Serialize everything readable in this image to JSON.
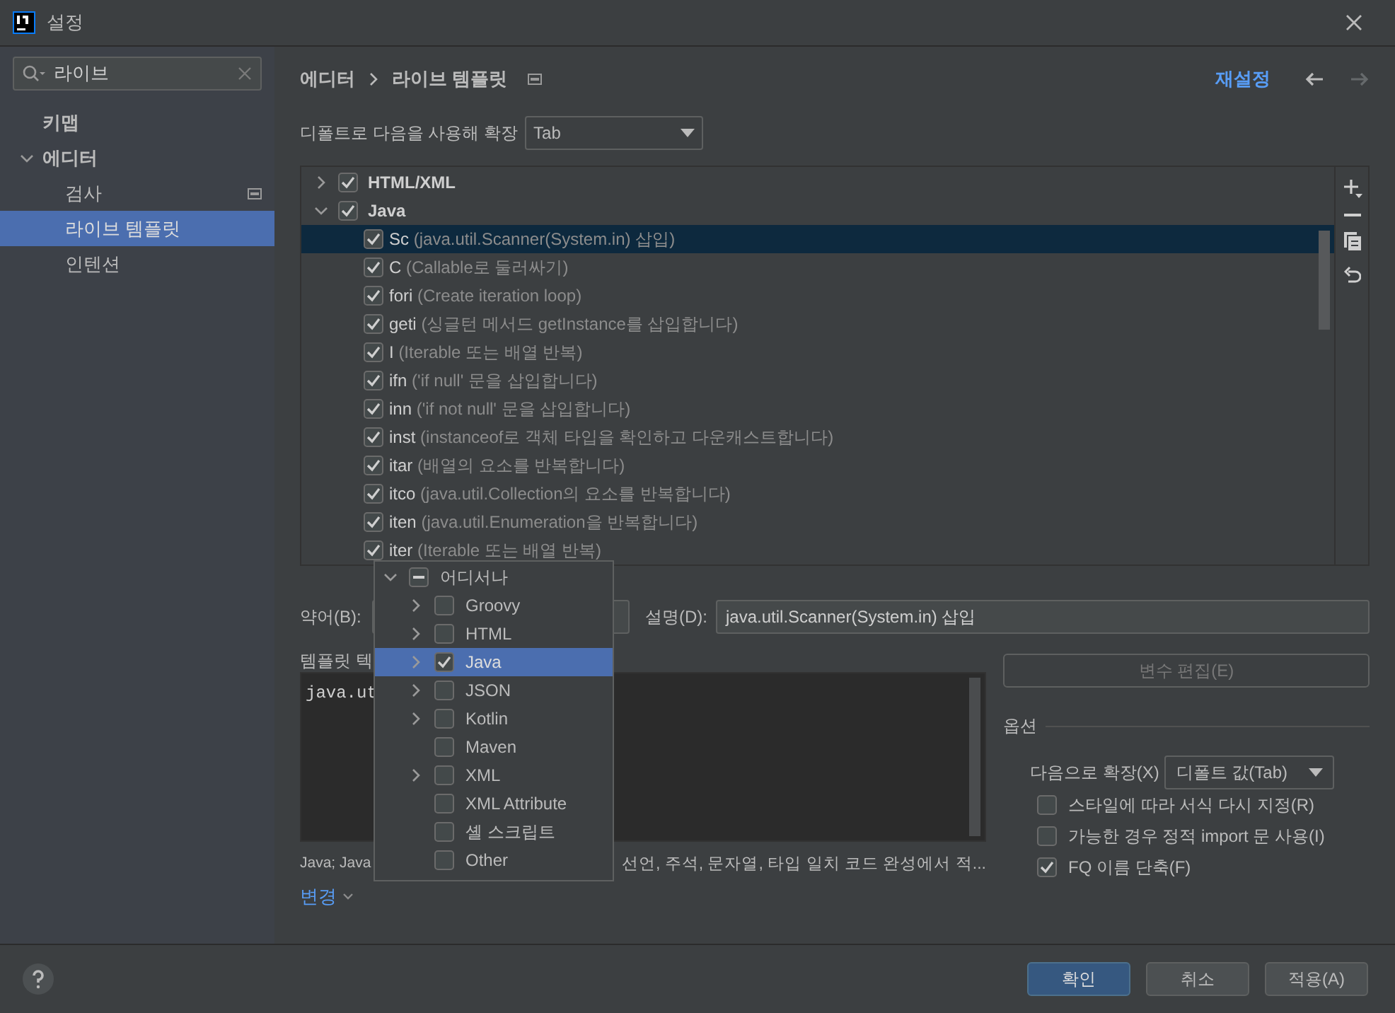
{
  "window": {
    "title": "설정"
  },
  "search": {
    "value": "라이브"
  },
  "sidebar": {
    "items": [
      {
        "label": "키맵",
        "selected": false
      },
      {
        "label": "에디터",
        "selected": false,
        "expanded": true,
        "children": [
          {
            "label": "검사",
            "selected": false,
            "has_badge": true
          },
          {
            "label": "라이브 템플릿",
            "selected": true
          },
          {
            "label": "인텐션",
            "selected": false
          }
        ]
      }
    ]
  },
  "breadcrumb": [
    "에디터",
    "라이브 템플릿"
  ],
  "reset_link": "재설정",
  "expand_with": {
    "label": "디폴트로 다음을 사용해 확장",
    "value": "Tab"
  },
  "template_groups": [
    {
      "name": "HTML/XML",
      "checked": true,
      "expanded": false
    },
    {
      "name": "Java",
      "checked": true,
      "expanded": true,
      "templates": [
        {
          "abbr": "Sc",
          "description": "(java.util.Scanner(System.in) 삽입)",
          "checked": true,
          "selected": true
        },
        {
          "abbr": "C",
          "description": "(Callable로 둘러싸기)",
          "checked": true,
          "selected": false
        },
        {
          "abbr": "fori",
          "description": "(Create iteration loop)",
          "checked": true,
          "selected": false
        },
        {
          "abbr": "geti",
          "description": "(싱글턴 메서드 getInstance를 삽입합니다)",
          "checked": true,
          "selected": false
        },
        {
          "abbr": "I",
          "description": "(Iterable 또는 배열 반복)",
          "checked": true,
          "selected": false
        },
        {
          "abbr": "ifn",
          "description": "('if null' 문을 삽입합니다)",
          "checked": true,
          "selected": false
        },
        {
          "abbr": "inn",
          "description": "('if not null' 문을 삽입합니다)",
          "checked": true,
          "selected": false
        },
        {
          "abbr": "inst",
          "description": "(instanceof로 객체 타입을 확인하고 다운캐스트합니다)",
          "checked": true,
          "selected": false
        },
        {
          "abbr": "itar",
          "description": "(배열의 요소를 반복합니다)",
          "checked": true,
          "selected": false
        },
        {
          "abbr": "itco",
          "description": "(java.util.Collection의 요소를 반복합니다)",
          "checked": true,
          "selected": false
        },
        {
          "abbr": "iten",
          "description": "(java.util.Enumeration을 반복합니다)",
          "checked": true,
          "selected": false
        },
        {
          "abbr": "iter",
          "description": "(Iterable 또는 배열 반복)",
          "checked": true,
          "selected": false
        }
      ]
    }
  ],
  "abbreviation": {
    "label": "약어(B):"
  },
  "description": {
    "label": "설명(D):",
    "value": "java.util.Scanner(System.in) 삽입"
  },
  "template_text": {
    "label": "템플릿 텍",
    "code": "java.ut"
  },
  "edit_variables": {
    "label": "변수 편집(E)",
    "disabled": true
  },
  "options": {
    "title": "옵션",
    "expand_label": "다음으로 확장(X)",
    "expand_value": "디폴트 값(Tab)",
    "checkboxes": [
      {
        "label": "스타일에 따라 서식 다시 지정(R)",
        "checked": false
      },
      {
        "label": "가능한 경우 정적 import 문 사용(I)",
        "checked": false
      },
      {
        "label": "FQ 이름 단축(F)",
        "checked": true
      }
    ]
  },
  "context": {
    "text_start": "Java; Java",
    "text_end": "선언, 주석, 문자열, 타입 일치 코드 완성에서 적...",
    "change_link": "변경"
  },
  "context_popup": {
    "label": "어디서나",
    "indeterminate": true,
    "expanded": true,
    "children": [
      {
        "label": "Groovy",
        "checked": false,
        "expandable": true,
        "selected": false
      },
      {
        "label": "HTML",
        "checked": false,
        "expandable": true,
        "selected": false
      },
      {
        "label": "Java",
        "checked": true,
        "expandable": true,
        "selected": true
      },
      {
        "label": "JSON",
        "checked": false,
        "expandable": true,
        "selected": false
      },
      {
        "label": "Kotlin",
        "checked": false,
        "expandable": true,
        "selected": false
      },
      {
        "label": "Maven",
        "checked": false,
        "expandable": false,
        "selected": false
      },
      {
        "label": "XML",
        "checked": false,
        "expandable": true,
        "selected": false
      },
      {
        "label": "XML Attribute",
        "checked": false,
        "expandable": false,
        "selected": false
      },
      {
        "label": "셸 스크립트",
        "checked": false,
        "expandable": false,
        "selected": false
      },
      {
        "label": "Other",
        "checked": false,
        "expandable": false,
        "selected": false
      }
    ]
  },
  "buttons": [
    {
      "label": "확인",
      "kind": "primary"
    },
    {
      "label": "취소",
      "kind": "normal"
    },
    {
      "label": "적용(A)",
      "kind": "normal"
    }
  ]
}
